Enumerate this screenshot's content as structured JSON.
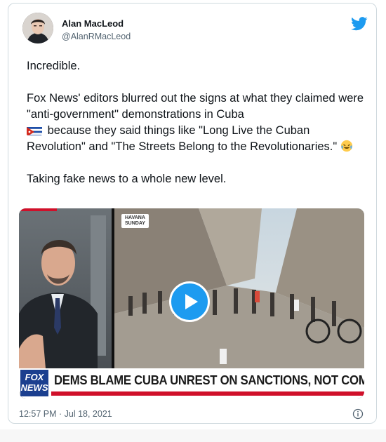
{
  "author": {
    "name": "Alan MacLeod",
    "handle": "@AlanRMacLeod"
  },
  "tweet": {
    "line1": "Incredible.",
    "line2a": "Fox News' editors blurred out the signs at what they claimed were \"anti-government\" demonstrations in Cuba",
    "line2b": "because they said things like \"Long Live the Cuban Revolution\" and \"The Streets Belong to the Revolutionaries.\"",
    "line3": "Taking fake news to a whole new level."
  },
  "media": {
    "location_tag_line1": "HAVANA",
    "location_tag_line2": "SUNDAY",
    "logo_line1": "FOX",
    "logo_line2": "NEWS",
    "headline": "DEMS BLAME CUBA UNREST ON SANCTIONS, NOT COMMUNISM"
  },
  "meta": {
    "timestamp": "12:57 PM · Jul 18, 2021"
  },
  "icons": {
    "brand": "twitter-bird-icon",
    "play": "play-icon",
    "info": "info-icon"
  },
  "colors": {
    "accent": "#1d9bf0",
    "fox_blue": "#1b3f8f",
    "fox_red": "#d0102a"
  }
}
